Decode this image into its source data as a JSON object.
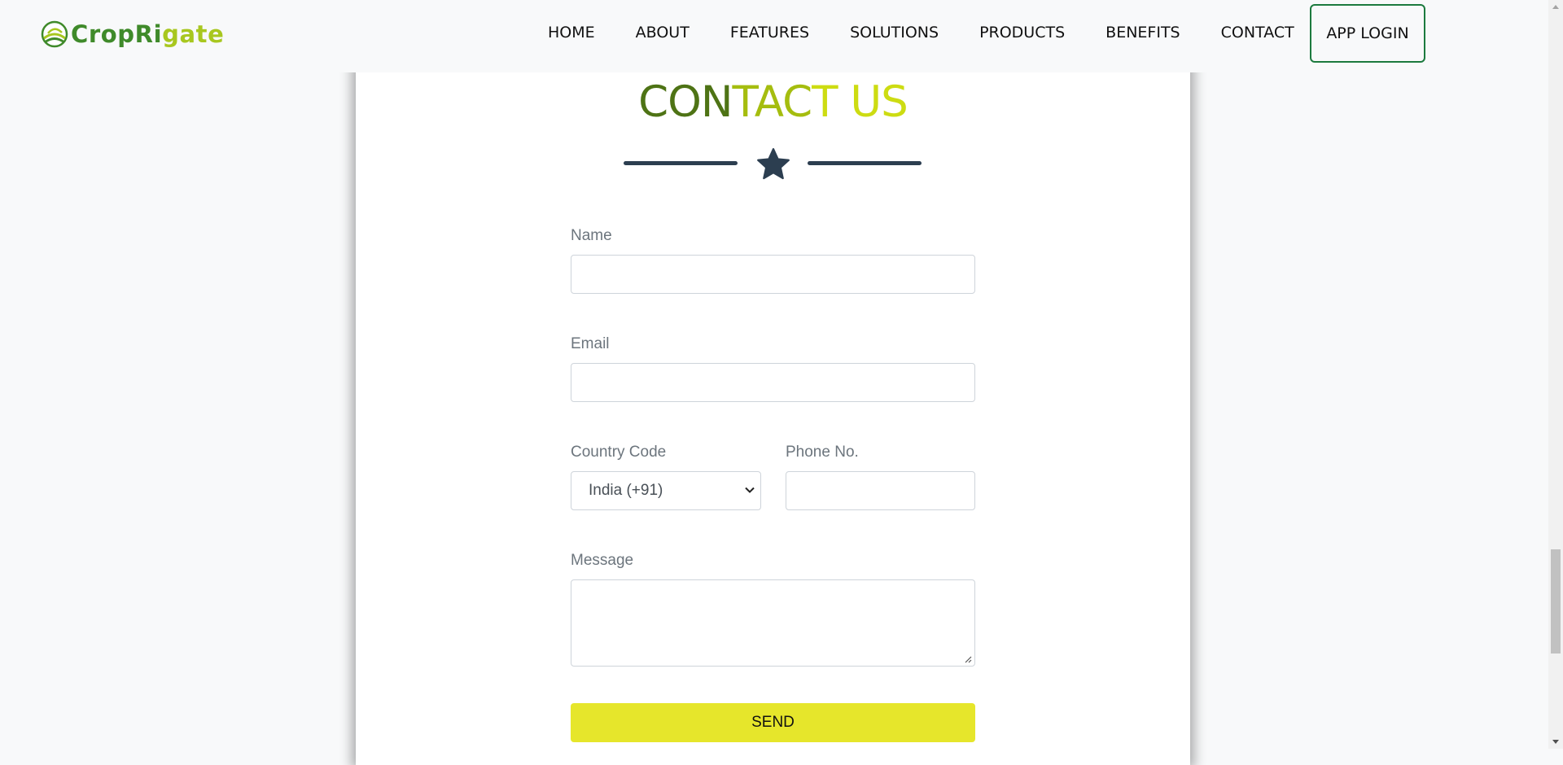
{
  "brand": {
    "name_part1": "CropRi",
    "name_part2": "gate",
    "logo_icon": "field-leaf-logo-icon"
  },
  "nav": {
    "items": [
      "HOME",
      "ABOUT",
      "FEATURES",
      "SOLUTIONS",
      "PRODUCTS",
      "BENEFITS",
      "CONTACT"
    ],
    "login_label": "APP LOGIN"
  },
  "contact": {
    "title_part1": "CON",
    "title_part2": "TAC",
    "title_part3": "T US",
    "divider_icon": "star-icon",
    "form": {
      "name_label": "Name",
      "name_value": "",
      "email_label": "Email",
      "email_value": "",
      "country_code_label": "Country Code",
      "country_code_selected": "India (+91)",
      "phone_label": "Phone No.",
      "phone_value": "",
      "message_label": "Message",
      "message_value": "",
      "send_label": "SEND"
    }
  },
  "colors": {
    "title_dark": "#4e7315",
    "title_mid": "#a5bd0f",
    "title_light": "#cddc12",
    "send_button": "#e6e62b",
    "login_border": "#1c7a3e",
    "divider": "#2c3e50"
  }
}
